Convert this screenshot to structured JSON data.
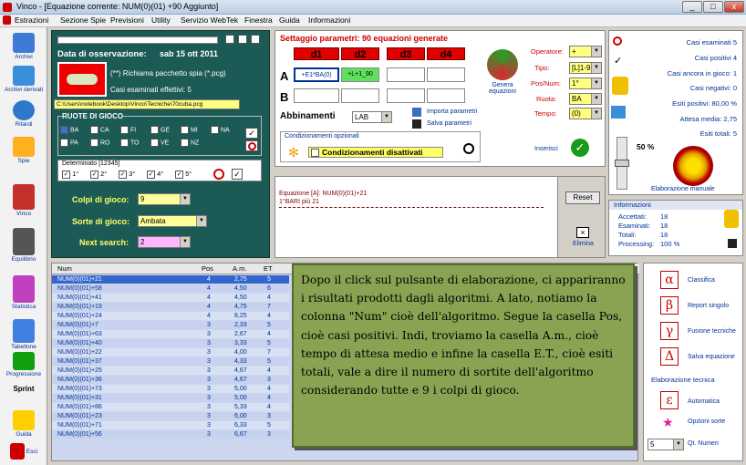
{
  "window": {
    "title": "Vinco - [Equazione corrente: NUM(0)(01) +90 Aggiunto]",
    "btn_min": "_",
    "btn_max": "□",
    "btn_close": "x"
  },
  "menu": [
    "Estrazioni",
    "Sezione Spie",
    "Previsioni",
    "Utility",
    "Servizio WebTek",
    "Finestra",
    "Guida",
    "Informazioni"
  ],
  "sidebar": [
    {
      "label": "Archivi",
      "color": "#3d7bd6"
    },
    {
      "label": "Archivi derivati",
      "color": "#3a8fdd"
    },
    {
      "label": "Ritardi",
      "color": "#2d78c8"
    },
    {
      "label": "Spie",
      "color": "#ffb020"
    },
    {
      "label": "Vinco",
      "color": "#c4302b"
    },
    {
      "label": "Equilibrio",
      "color": "#555555"
    },
    {
      "label": "Statistica",
      "color": "#c040c0"
    },
    {
      "label": "Tabellone",
      "color": "#4080e0"
    },
    {
      "label": "Progressione",
      "color": "#10a010"
    },
    {
      "label": "Sprint",
      "color": "#ffd000"
    },
    {
      "label": "Guida",
      "color": "#406080"
    },
    {
      "label": "Esci",
      "color": "#cc0000"
    }
  ],
  "obs": {
    "date_label": "Data di osservazione:",
    "date_value": "sab 15 ott 2011",
    "pkg_text": "(**) Richiama pacchetto spia (*.pcg)",
    "cases_label": "Casi esaminati effettivi: 5",
    "path": "C:\\Users\\notebook\\Desktop\\Vinco\\Tecniche\\70cuba.pcg",
    "ruote_title": "RUOTE DI GIOCO",
    "ruote": [
      "BA",
      "CA",
      "FI",
      "GE",
      "MI",
      "NA",
      "PA",
      "RO",
      "TO",
      "VE",
      "NZ"
    ],
    "determinato_title": "Determinato [12345]",
    "determinato": [
      "1°",
      "2°",
      "3°",
      "4°",
      "5°"
    ],
    "colpi_label": "Colpi di gioco:",
    "colpi_value": "9",
    "sorte_label": "Sorte di gioco:",
    "sorte_value": "Ambata",
    "next_label": "Next search:",
    "next_value": "2"
  },
  "params": {
    "title": "Settaggio parametri: 90 equazioni generate",
    "headers": [
      "d1",
      "d2",
      "d3",
      "d4"
    ],
    "rowA": "A",
    "rowB": "B",
    "a_cells": [
      "+E1*BA(0)",
      "+L+1_90"
    ],
    "genera": "Genera equazioni",
    "abbinamenti": "Abbinamenti",
    "abb_value": "LAB",
    "importa": "Importa parametri",
    "salva": "Salva parametri",
    "cond_title": "Condizionamenti opzionali",
    "cond_text": "Condizionamenti disattivati",
    "inserisci": "Inserisci",
    "operatore_label": "Operatore:",
    "operatore_value": "+",
    "tipo_label": "Tipo:",
    "tipo_value": "[L]1-90",
    "pos_label": "Pos/Num:",
    "pos_value": "1°",
    "ruota_label": "Ruota:",
    "ruota_value": "BA",
    "tempo_label": "Tempo:",
    "tempo_value": "(0)"
  },
  "equation": {
    "lines": [
      "Equazione [A]: NUM(0)(01)+21",
      "1°BARI più 21"
    ],
    "reset": "Reset",
    "elimina": "Elimina"
  },
  "stats": {
    "rows": [
      "Casi esaminati 5",
      "Casi positivi 4",
      "Casi ancora in gioco: 1",
      "Casi negativi: 0",
      "Esiti positivi: 80,00 %",
      "Attesa media: 2,75",
      "Esiti totali: 5"
    ],
    "percent": "50 %",
    "elab": "Elaborazione manuale"
  },
  "info": {
    "title": "Informazioni",
    "rows": [
      [
        "Accettati:",
        "18"
      ],
      [
        "Esaminati:",
        "18"
      ],
      [
        "Totali:",
        "18"
      ],
      [
        "Processing:",
        "100 %"
      ]
    ]
  },
  "table": {
    "headers": [
      "Num",
      "Pos",
      "A.m.",
      "ET"
    ],
    "rows": [
      [
        "NUM(0)(01)+21",
        "4",
        "2,75",
        "5"
      ],
      [
        "NUM(0)(01)+58",
        "4",
        "4,50",
        "6"
      ],
      [
        "NUM(0)(01)+41",
        "4",
        "4,50",
        "4"
      ],
      [
        "NUM(0)(01)+19",
        "4",
        "4,75",
        "7"
      ],
      [
        "NUM(0)(01)+24",
        "4",
        "8,25",
        "4"
      ],
      [
        "NUM(0)(01)+7",
        "3",
        "2,33",
        "5"
      ],
      [
        "NUM(0)(01)+63",
        "3",
        "2,67",
        "4"
      ],
      [
        "NUM(0)(01)+40",
        "3",
        "3,33",
        "5"
      ],
      [
        "NUM(0)(01)+22",
        "3",
        "4,00",
        "7"
      ],
      [
        "NUM(0)(01)+37",
        "3",
        "4,33",
        "5"
      ],
      [
        "NUM(0)(01)+25",
        "3",
        "4,67",
        "4"
      ],
      [
        "NUM(0)(01)+36",
        "3",
        "4,67",
        "3"
      ],
      [
        "NUM(0)(01)+73",
        "3",
        "5,00",
        "4"
      ],
      [
        "NUM(0)(01)+31",
        "3",
        "5,00",
        "4"
      ],
      [
        "NUM(0)(01)+86",
        "3",
        "5,33",
        "4"
      ],
      [
        "NUM(0)(01)+23",
        "3",
        "6,00",
        "3"
      ],
      [
        "NUM(0)(01)+71",
        "3",
        "6,33",
        "5"
      ],
      [
        "NUM(0)(01)+56",
        "3",
        "6,67",
        "3"
      ]
    ]
  },
  "note": "Dopo il click sul pulsante di elaborazione, ci appariranno i risultati prodotti dagli algoritmi. A lato, notiamo la colonna \"Num\" cioè dell'algoritmo. Segue la casella Pos, cioè casi positivi. Indi, troviamo la casella A.m., cioè tempo di attesa medio e infine la casella E.T., cioè esiti totali, vale a dire il numero di sortite dell'algoritmo considerando tutte e 9 i colpi di gioco.",
  "tools": {
    "items": [
      {
        "glyph": "α",
        "label": "Classifica"
      },
      {
        "glyph": "β",
        "label": "Report singolo"
      },
      {
        "glyph": "γ",
        "label": "Fusione tecniche"
      },
      {
        "glyph": "Δ",
        "label": "Salva equazione"
      }
    ],
    "section": "Elaborazione tecnica",
    "auto_glyph": "ε",
    "auto": "Automatica",
    "opzioni_glyph": "★",
    "opzioni": "Opzioni sorte",
    "qt_value": "5",
    "qt_label": "Qt. Numeri"
  }
}
